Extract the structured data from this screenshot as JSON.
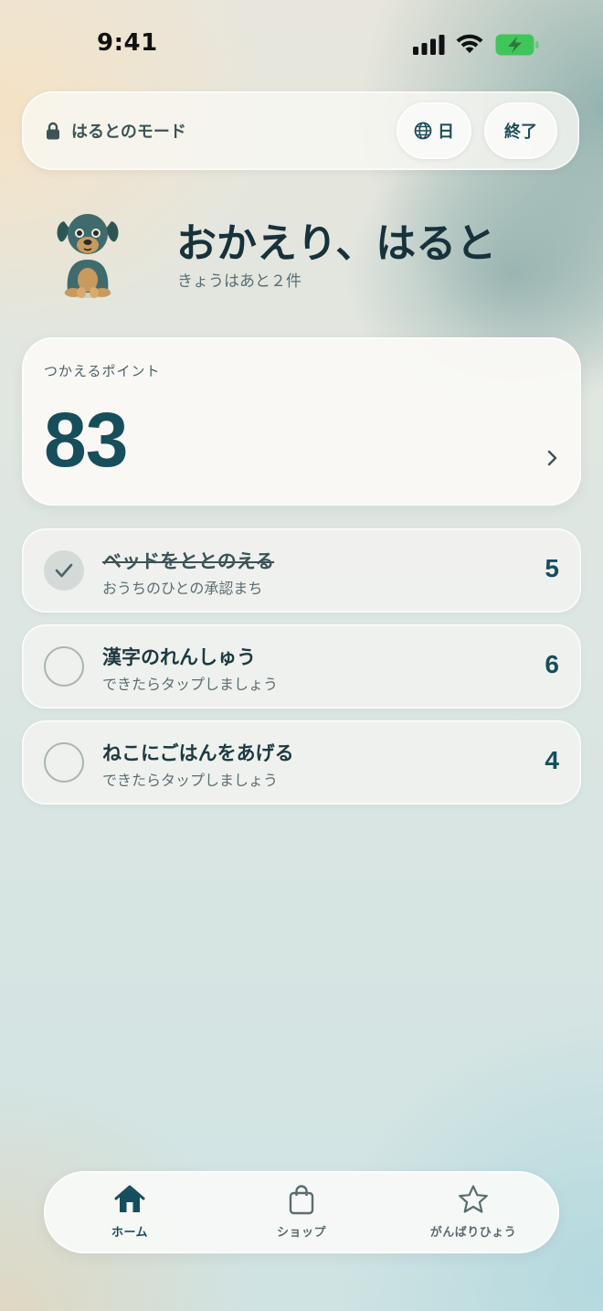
{
  "status_bar": {
    "time": "9:41"
  },
  "top_bar": {
    "mode_label": "はるとのモード",
    "language_label": "日",
    "end_label": "終了"
  },
  "header": {
    "greeting": "おかえり、はると",
    "remaining": "きょうはあと２件"
  },
  "points_card": {
    "label": "つかえるポイント",
    "value": "83"
  },
  "tasks": [
    {
      "title": "ベッドをととのえる",
      "subtitle": "おうちのひとの承認まち",
      "points": "5",
      "done": true
    },
    {
      "title": "漢字のれんしゅう",
      "subtitle": "できたらタップしましょう",
      "points": "6",
      "done": false
    },
    {
      "title": "ねこにごはんをあげる",
      "subtitle": "できたらタップしましょう",
      "points": "4",
      "done": false
    }
  ],
  "tab_bar": {
    "items": [
      {
        "label": "ホーム",
        "icon": "home-icon",
        "active": true
      },
      {
        "label": "ショップ",
        "icon": "shopping-bag-icon",
        "active": false
      },
      {
        "label": "がんばりひょう",
        "icon": "star-icon",
        "active": false
      }
    ]
  },
  "colors": {
    "accent": "#174e5b",
    "text": "#1c3a40",
    "muted": "#5a6e72",
    "battery": "#3fc65a"
  }
}
